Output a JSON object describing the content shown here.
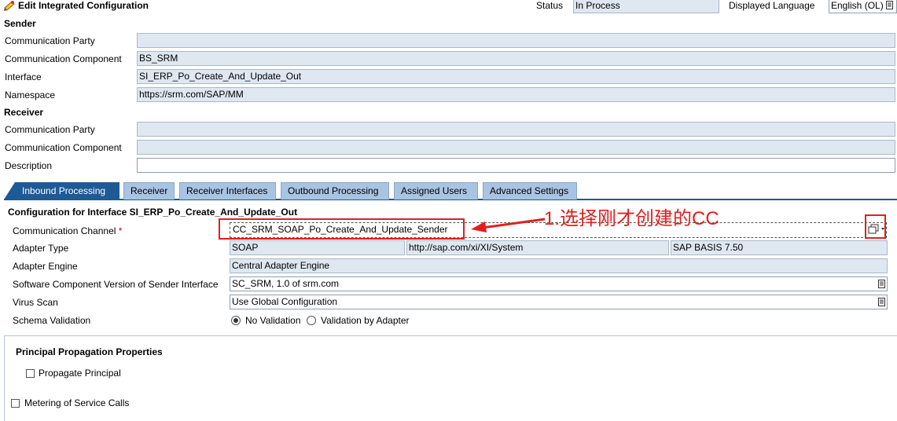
{
  "header": {
    "title": "Edit Integrated Configuration",
    "status_label": "Status",
    "status_value": "In Process",
    "language_label": "Displayed Language",
    "language_value": "English (OL)"
  },
  "sender": {
    "heading": "Sender",
    "party_label": "Communication Party",
    "party_value": "",
    "component_label": "Communication Component",
    "component_value": "BS_SRM",
    "interface_label": "Interface",
    "interface_value": "SI_ERP_Po_Create_And_Update_Out",
    "namespace_label": "Namespace",
    "namespace_value": "https://srm.com/SAP/MM"
  },
  "receiver": {
    "heading": "Receiver",
    "party_label": "Communication Party",
    "party_value": "",
    "component_label": "Communication Component",
    "component_value": "",
    "description_label": "Description",
    "description_value": ""
  },
  "tabs": [
    {
      "label": "Inbound Processing"
    },
    {
      "label": "Receiver"
    },
    {
      "label": "Receiver Interfaces"
    },
    {
      "label": "Outbound Processing"
    },
    {
      "label": "Assigned Users"
    },
    {
      "label": "Advanced Settings"
    }
  ],
  "config": {
    "heading": "Configuration for Interface SI_ERP_Po_Create_And_Update_Out",
    "channel_label": "Communication Channel",
    "required_mark": "*",
    "channel_value": "CC_SRM_SOAP_Po_Create_And_Update_Sender",
    "adapter_type_label": "Adapter Type",
    "adapter_type_value": "SOAP",
    "adapter_ns_value": "http://sap.com/xi/XI/System",
    "adapter_swc_value": "SAP BASIS 7.50",
    "adapter_engine_label": "Adapter Engine",
    "adapter_engine_value": "Central Adapter Engine",
    "swcv_label": "Software Component Version of Sender Interface",
    "swcv_value": "SC_SRM, 1.0 of srm.com",
    "virus_label": "Virus Scan",
    "virus_value": "Use Global Configuration",
    "schema_label": "Schema Validation",
    "schema_option_none": "No Validation",
    "schema_option_adapter": "Validation by Adapter"
  },
  "principal": {
    "heading": "Principal Propagation Properties",
    "propagate_label": "Propagate Principal"
  },
  "metering": {
    "label": "Metering of Service Calls"
  },
  "annotation": {
    "text": "1.选择刚才创建的CC",
    "color": "#e02020"
  }
}
